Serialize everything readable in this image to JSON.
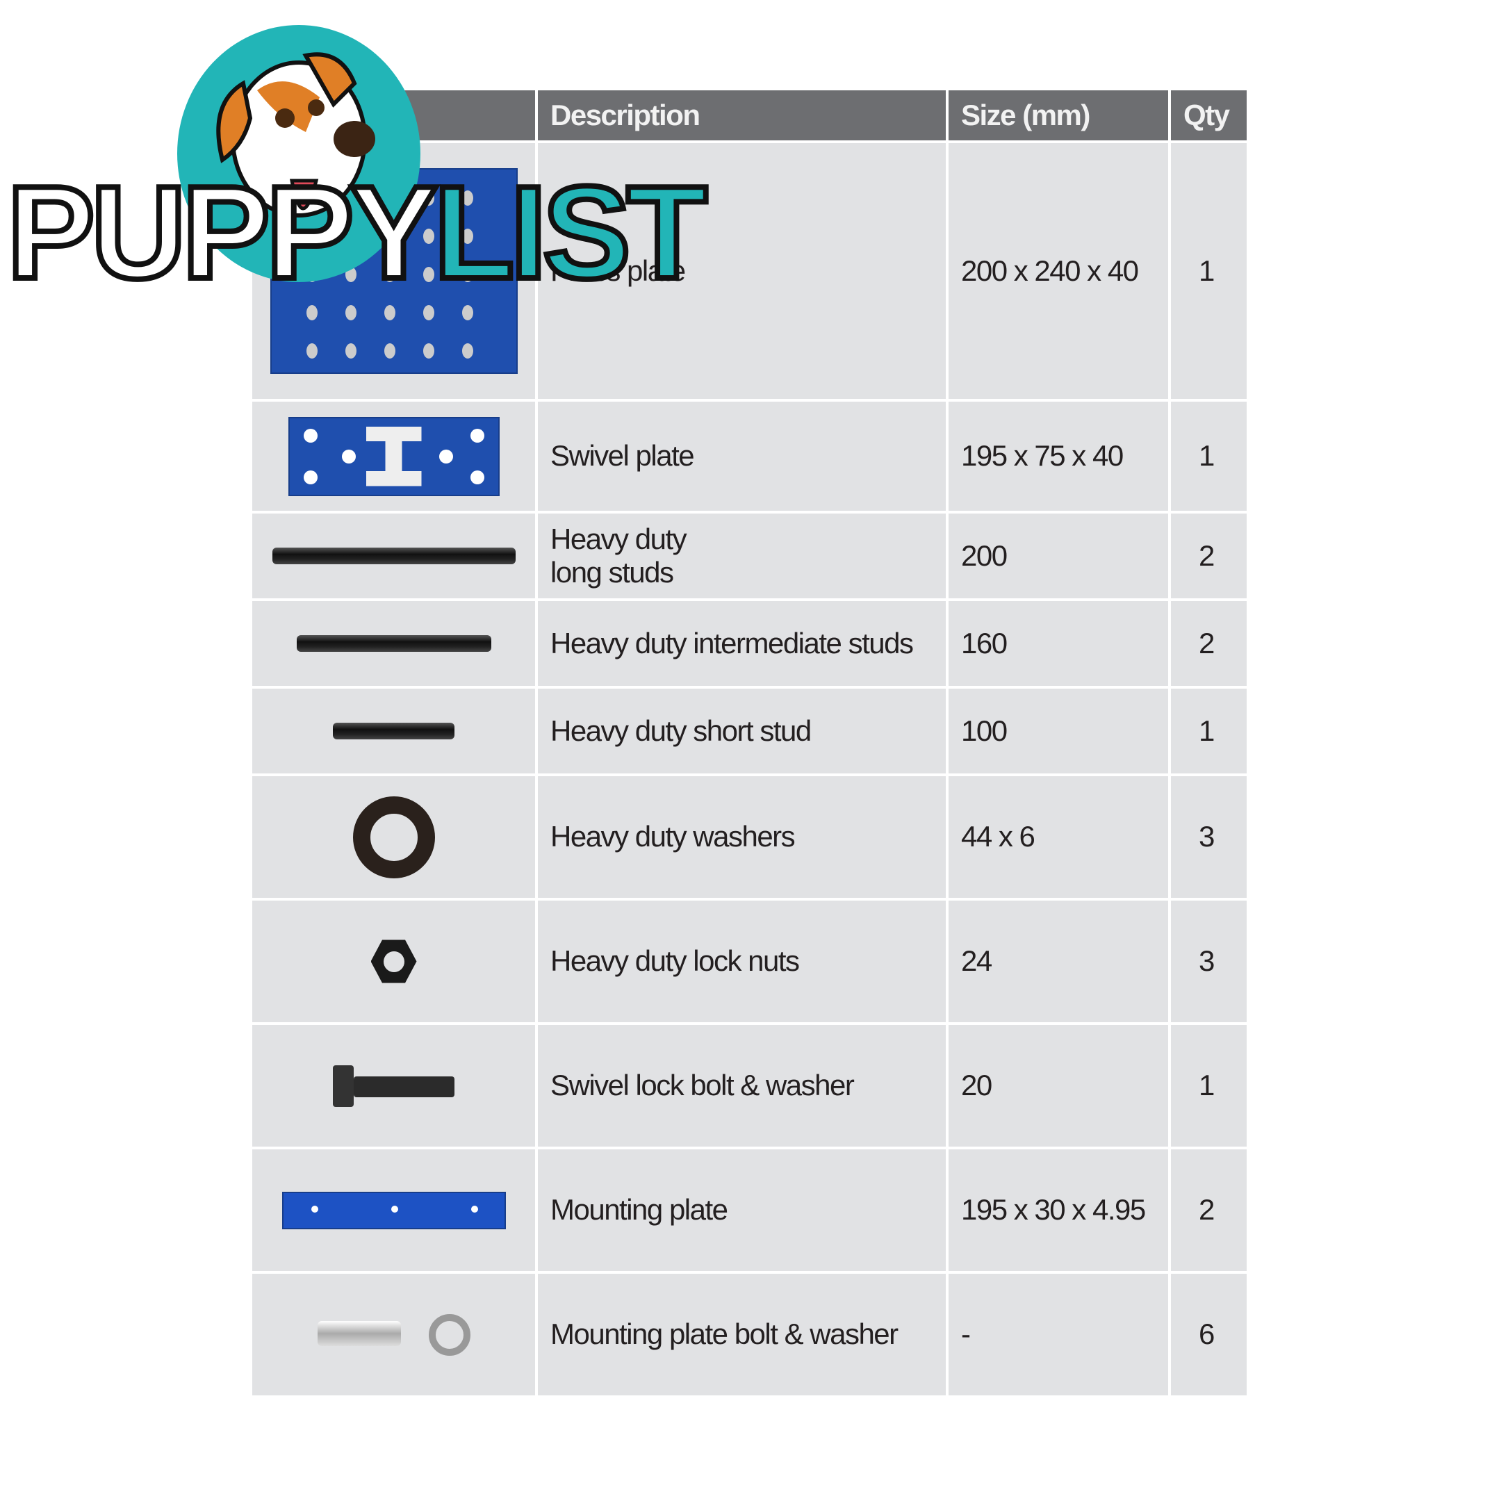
{
  "logo": {
    "text_a": "PUPPY",
    "text_b": "LIST",
    "brand_color": "#22b5b7"
  },
  "table": {
    "headers": [
      "",
      "Description",
      "Size (mm)",
      "Qty"
    ],
    "rows": [
      {
        "image": "press-plate",
        "description": "Press plate",
        "size": "200 x 240 x 40",
        "qty": "1"
      },
      {
        "image": "swivel-plate",
        "description": "Swivel plate",
        "size": "195 x 75 x 40",
        "qty": "1"
      },
      {
        "image": "long-stud",
        "description": "Heavy duty long studs",
        "size": "200",
        "qty": "2"
      },
      {
        "image": "intermediate-stud",
        "description": "Heavy duty intermediate studs",
        "size": "160",
        "qty": "2"
      },
      {
        "image": "short-stud",
        "description": "Heavy duty short stud",
        "size": "100",
        "qty": "1"
      },
      {
        "image": "washer",
        "description": "Heavy duty washers",
        "size": "44 x 6",
        "qty": "3"
      },
      {
        "image": "lock-nut",
        "description": "Heavy duty lock nuts",
        "size": "24",
        "qty": "3"
      },
      {
        "image": "bolt-washer",
        "description": "Swivel lock bolt & washer",
        "size": "20",
        "qty": "1"
      },
      {
        "image": "mounting-plate",
        "description": "Mounting plate",
        "size": "195 x 30 x 4.95",
        "qty": "2"
      },
      {
        "image": "mounting-bolt-washer",
        "description": "Mounting plate bolt & washer",
        "size": "-",
        "qty": "6"
      }
    ]
  }
}
